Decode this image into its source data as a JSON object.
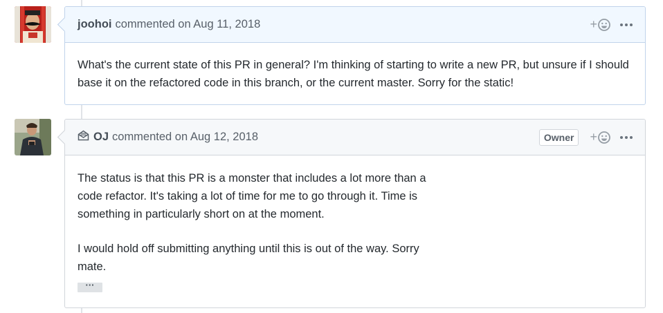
{
  "comments": [
    {
      "author": "joohoi",
      "action": "commented on Aug 11, 2018",
      "body": [
        "What's the current state of this PR in general? I'm thinking of starting to write a new PR, but unsure if I should base it on the refactored code in this branch, or the current master. Sorry for the static!"
      ],
      "reaction_label": "+"
    },
    {
      "author": "OJ",
      "action": "commented on Aug 12, 2018",
      "badge": "Owner",
      "body": [
        "The status is that this PR is a monster that includes a lot more than a code refactor. It's taking a lot of time for me to go through it. Time is something in particularly short on at the moment.",
        "I would hold off submitting anything until this is out of the way. Sorry mate."
      ],
      "reaction_label": "+",
      "hidden_text_button": "···"
    }
  ],
  "icons": {
    "reaction": "smiley-icon",
    "more": "kebab-horizontal-icon",
    "email": "mail-read-icon"
  },
  "colors": {
    "highlight_header": "#f1f8ff",
    "default_header": "#f6f8fa",
    "border": "#d1d5da"
  }
}
